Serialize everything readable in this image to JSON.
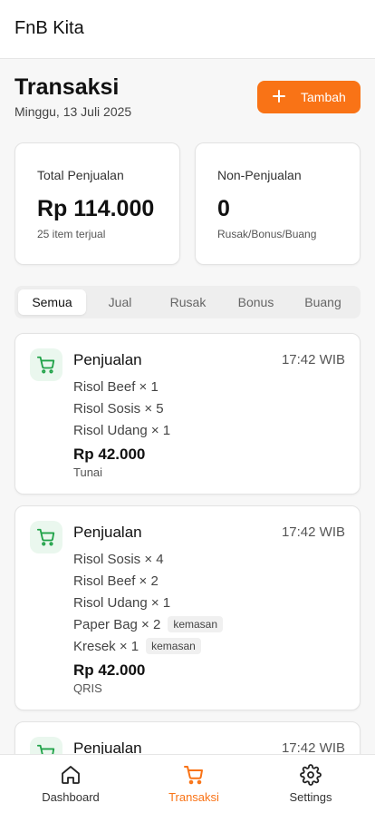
{
  "app": {
    "title": "FnB Kita"
  },
  "header": {
    "title": "Transaksi",
    "date": "Minggu, 13 Juli 2025",
    "add_label": "Tambah"
  },
  "stats": {
    "sales": {
      "label": "Total Penjualan",
      "value": "Rp 114.000",
      "sub": "25 item terjual"
    },
    "non_sales": {
      "label": "Non-Penjualan",
      "value": "0",
      "sub": "Rusak/Bonus/Buang"
    }
  },
  "tabs": [
    {
      "label": "Semua",
      "active": true
    },
    {
      "label": "Jual",
      "active": false
    },
    {
      "label": "Rusak",
      "active": false
    },
    {
      "label": "Bonus",
      "active": false
    },
    {
      "label": "Buang",
      "active": false
    }
  ],
  "transactions": [
    {
      "type": "Penjualan",
      "time": "17:42 WIB",
      "items": [
        {
          "text": "Risol Beef × 1",
          "tag": ""
        },
        {
          "text": "Risol Sosis × 5",
          "tag": ""
        },
        {
          "text": "Risol Udang × 1",
          "tag": ""
        }
      ],
      "total": "Rp 42.000",
      "method": "Tunai"
    },
    {
      "type": "Penjualan",
      "time": "17:42 WIB",
      "items": [
        {
          "text": "Risol Sosis × 4",
          "tag": ""
        },
        {
          "text": "Risol Beef × 2",
          "tag": ""
        },
        {
          "text": "Risol Udang × 1",
          "tag": ""
        },
        {
          "text": "Paper Bag × 2",
          "tag": "kemasan"
        },
        {
          "text": "Kresek × 1",
          "tag": "kemasan"
        }
      ],
      "total": "Rp 42.000",
      "method": "QRIS"
    },
    {
      "type": "Penjualan",
      "time": "17:42 WIB"
    }
  ],
  "nav": [
    {
      "label": "Dashboard",
      "icon": "home-icon",
      "active": false
    },
    {
      "label": "Transaksi",
      "icon": "cart-icon",
      "active": true
    },
    {
      "label": "Settings",
      "icon": "gear-icon",
      "active": false
    }
  ],
  "colors": {
    "accent": "#f97316",
    "sale_icon": "#22a34a",
    "sale_icon_bg": "#eaf7ee"
  }
}
